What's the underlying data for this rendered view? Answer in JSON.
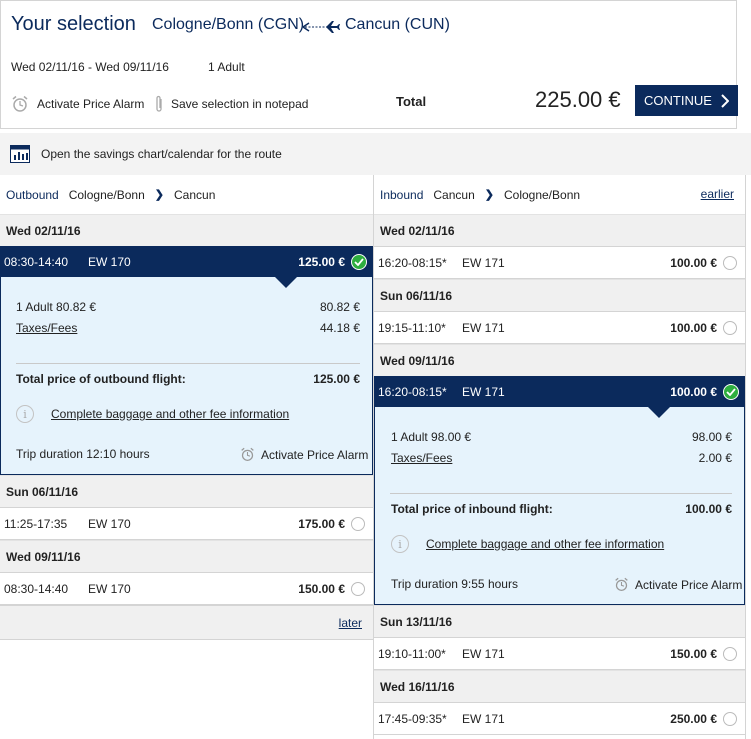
{
  "summary": {
    "title": "Your selection",
    "from": "Cologne/Bonn (CGN)",
    "to": "Cancun (CUN)",
    "dates": "Wed 02/11/16 - Wed 09/11/16",
    "passengers": "1 Adult",
    "alarm_label": "Activate Price Alarm",
    "notepad_label": "Save selection in notepad",
    "total_label": "Total",
    "total_price": "225.00 €",
    "continue_label": "CONTINUE"
  },
  "savings_label": "Open the savings chart/calendar for the route",
  "outbound": {
    "label": "Outbound",
    "from": "Cologne/Bonn",
    "to": "Cancun",
    "later_label": "later",
    "day1": {
      "date": "Wed 02/11/16",
      "flight": {
        "time": "08:30-14:40",
        "number": "EW 170",
        "price": "125.00 €"
      }
    },
    "detail": {
      "adult_label": "1 Adult 80.82 €",
      "adult_value": "80.82 €",
      "taxes_label": "Taxes/Fees",
      "taxes_value": "44.18 €",
      "total_label": "Total price of outbound flight:",
      "total_value": "125.00 €",
      "baggage_link": "Complete baggage and other fee information",
      "duration": "Trip duration 12:10  hours",
      "alarm_label": "Activate Price Alarm"
    },
    "day2": {
      "date": "Sun 06/11/16",
      "flight": {
        "time": "11:25-17:35",
        "number": "EW 170",
        "price": "175.00 €"
      }
    },
    "day3": {
      "date": "Wed 09/11/16",
      "flight": {
        "time": "08:30-14:40",
        "number": "EW 170",
        "price": "150.00 €"
      }
    }
  },
  "inbound": {
    "label": "Inbound",
    "from": "Cancun",
    "to": "Cologne/Bonn",
    "earlier_label": "earlier",
    "day1": {
      "date": "Wed 02/11/16",
      "flight": {
        "time": "16:20-08:15*",
        "number": "EW 171",
        "price": "100.00 €"
      }
    },
    "day2": {
      "date": "Sun 06/11/16",
      "flight": {
        "time": "19:15-11:10*",
        "number": "EW 171",
        "price": "100.00 €"
      }
    },
    "day3": {
      "date": "Wed 09/11/16",
      "flight": {
        "time": "16:20-08:15*",
        "number": "EW 171",
        "price": "100.00 €"
      }
    },
    "detail": {
      "adult_label": "1 Adult 98.00 €",
      "adult_value": "98.00 €",
      "taxes_label": "Taxes/Fees",
      "taxes_value": "2.00 €",
      "total_label": "Total price of inbound flight:",
      "total_value": "100.00 €",
      "baggage_link": "Complete baggage and other fee information",
      "duration": "Trip duration 9:55  hours",
      "alarm_label": "Activate Price Alarm"
    },
    "day4": {
      "date": "Sun 13/11/16",
      "flight": {
        "time": "19:10-11:00*",
        "number": "EW 171",
        "price": "150.00 €"
      }
    },
    "day5": {
      "date": "Wed 16/11/16",
      "flight": {
        "time": "17:45-09:35*",
        "number": "EW 171",
        "price": "250.00 €"
      }
    }
  },
  "colors": {
    "navy": "#0b2a5c",
    "selected_bg": "#e6f3fc",
    "check_green": "#2eae3f"
  },
  "icons": [
    "plane-arrows-icon",
    "alarm-clock-icon",
    "paperclip-icon",
    "chevron-right-icon",
    "chart-icon",
    "info-icon",
    "check-icon"
  ]
}
